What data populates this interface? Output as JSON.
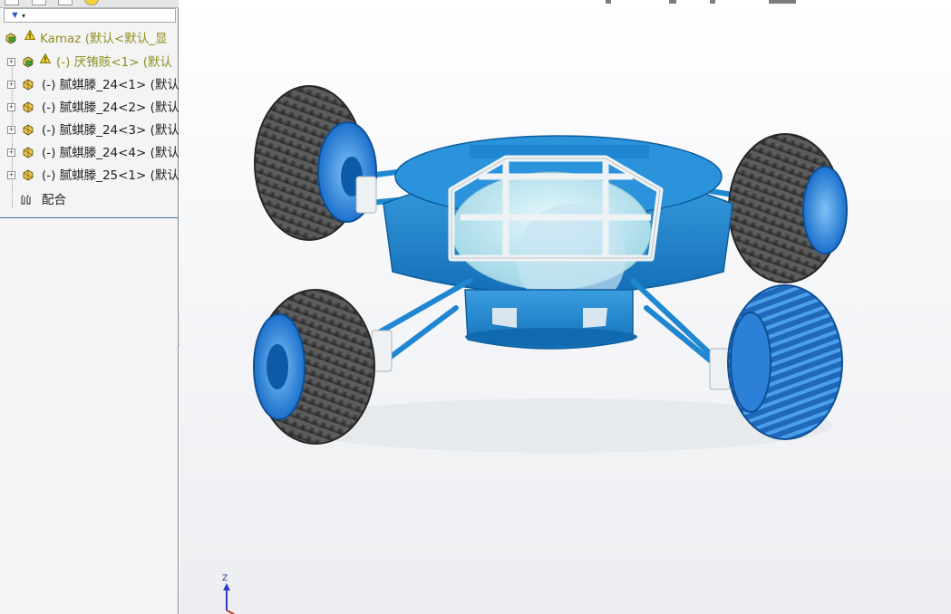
{
  "feature_tree": {
    "root": {
      "label": "Kamaz  (默认<默认_显",
      "icon": "assembly-icon",
      "warning": true
    },
    "items": [
      {
        "label": "(-) 厌铕赅<1> (默认",
        "icon": "assembly-icon",
        "warning": true,
        "style": "assembly"
      },
      {
        "label": "(-) 腻蜞滕_24<1> (默认",
        "icon": "part-icon",
        "warning": false,
        "style": "part"
      },
      {
        "label": "(-) 腻蜞滕_24<2> (默认",
        "icon": "part-icon",
        "warning": false,
        "style": "part"
      },
      {
        "label": "(-) 腻蜞滕_24<3> (默认",
        "icon": "part-icon",
        "warning": false,
        "style": "part"
      },
      {
        "label": "(-) 腻蜞滕_24<4> (默认",
        "icon": "part-icon",
        "warning": false,
        "style": "part"
      },
      {
        "label": "(-) 腻蜞滕_25<1> (默认",
        "icon": "part-icon",
        "warning": false,
        "style": "part"
      }
    ],
    "mates": {
      "label": "配合",
      "icon": "mates-icon"
    }
  },
  "filter": {
    "icon": "filter-icon"
  },
  "viewport": {
    "triad_axis_label": "Z",
    "colors": {
      "body_blue": "#1f86d2",
      "wheel_dark": "#4a4a4a",
      "wheel_selected": "#2b7fd6",
      "frame_white": "#e8ecef",
      "dome_cyan": "#bfe9f3",
      "background_top": "#ffffff",
      "background_bottom": "#eceef1"
    }
  }
}
